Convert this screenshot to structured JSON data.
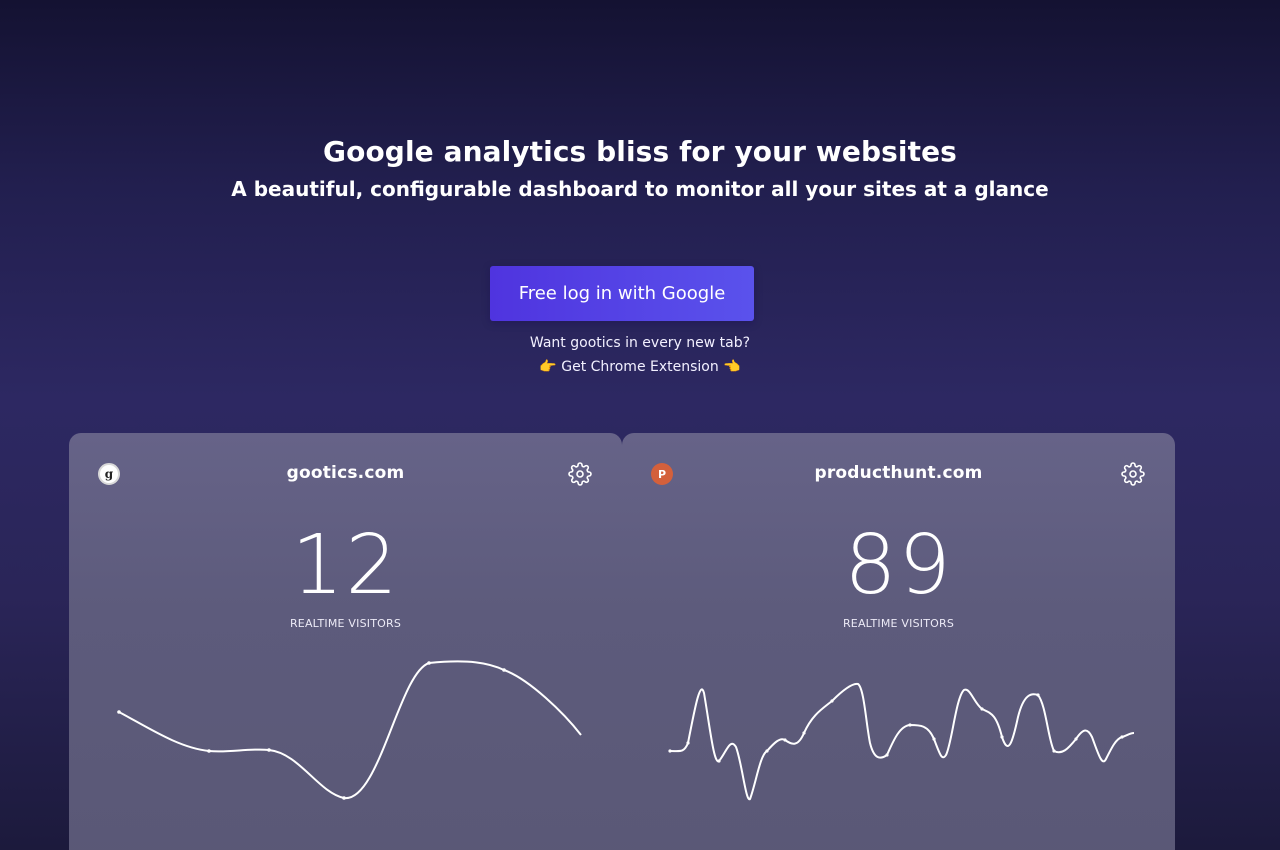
{
  "hero": {
    "title": "Google analytics bliss for your websites",
    "subtitle": "A beautiful, configurable dashboard to monitor all your sites at a glance"
  },
  "cta": {
    "label": "Free log in with Google"
  },
  "promo": {
    "question": "Want gootics in every new tab?",
    "extension_link": "👉 Get Chrome Extension 👈"
  },
  "cards": [
    {
      "site": "gootics.com",
      "favicon_letter": "g",
      "favicon_icon": "gootics-favicon-icon",
      "value": "12",
      "label": "REALTIME VISITORS",
      "settings_icon": "gear-icon"
    },
    {
      "site": "producthunt.com",
      "favicon_letter": "P",
      "favicon_icon": "producthunt-favicon-icon",
      "value": "89",
      "label": "REALTIME VISITORS",
      "settings_icon": "gear-icon"
    }
  ],
  "colors": {
    "button": "#5240e6",
    "producthunt_favicon": "#d4603b",
    "card": "#5f5d80"
  }
}
